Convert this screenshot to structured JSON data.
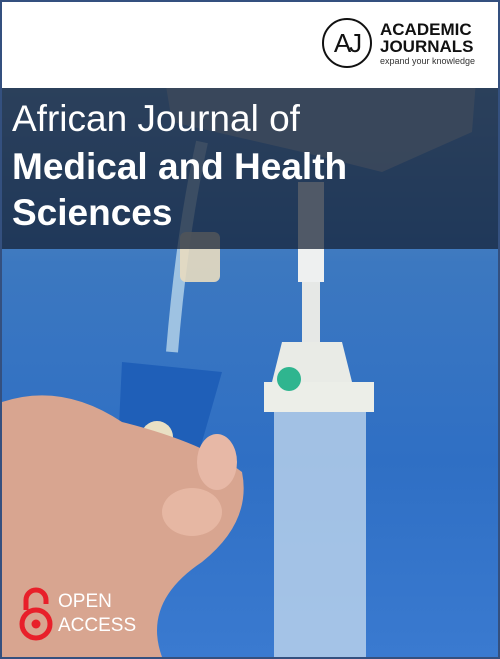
{
  "publisher": {
    "name_line1": "ACADEMIC",
    "name_line2": "JOURNALS",
    "tagline": "expand your knowledge",
    "monogram": "AJ"
  },
  "title": {
    "line1": "African Journal of",
    "line2": "Medical and Health",
    "line3": "Sciences"
  },
  "open_access": {
    "line1": "OPEN",
    "line2": "ACCESS"
  },
  "colors": {
    "border": "#34507f",
    "open_access_icon": "#e8202a"
  }
}
